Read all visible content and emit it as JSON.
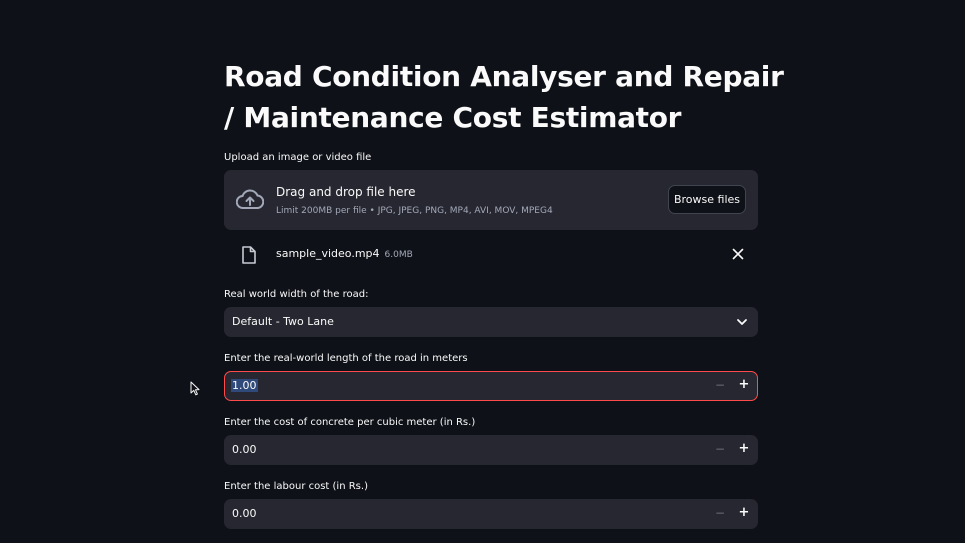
{
  "header": {
    "title_line1": "Road Condition Analyser and Repair",
    "title_line2": "/ Maintenance Cost Estimator"
  },
  "uploader": {
    "label": "Upload an image or video file",
    "drop_title": "Drag and drop file here",
    "drop_limits": "Limit 200MB per file • JPG, JPEG, PNG, MP4, AVI, MOV, MPEG4",
    "browse_label": "Browse files",
    "file_name": "sample_video.mp4",
    "file_size": "6.0MB"
  },
  "road_width": {
    "label": "Real world width of the road:",
    "selected": "Default - Two Lane"
  },
  "length_input": {
    "label": "Enter the real-world length of the road in meters",
    "value": "1.00"
  },
  "concrete_input": {
    "label": "Enter the cost of concrete per cubic meter (in Rs.)",
    "value": "0.00"
  },
  "labour_input": {
    "label": "Enter the labour cost (in Rs.)",
    "value": "0.00"
  },
  "stepper": {
    "minus": "−",
    "plus": "+"
  },
  "icons": {
    "upload": "cloud-upload-icon",
    "file": "file-icon",
    "close": "close-icon",
    "dropdown": "chevron-down-icon",
    "cursor": "mouse-pointer-icon"
  },
  "colors": {
    "background": "#0e1117",
    "surface": "#262730",
    "focus_border": "#ff4b4b",
    "text": "#fafafa",
    "muted": "#a3a8b8"
  }
}
